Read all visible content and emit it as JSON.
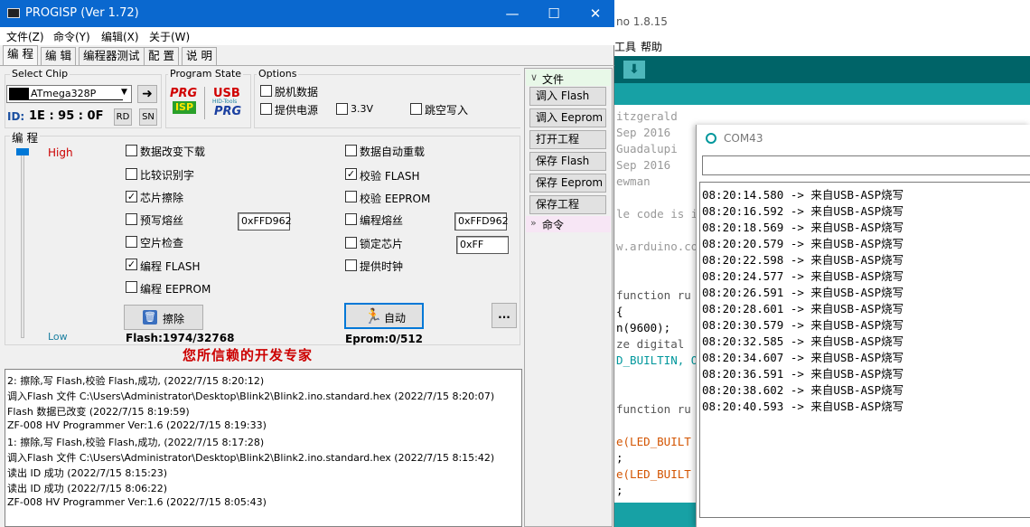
{
  "arduino": {
    "title": "no 1.8.15",
    "menu": [
      "工具",
      "帮助"
    ],
    "code_lines": [
      {
        "t": "itzgerald",
        "c": "#999"
      },
      {
        "t": "Sep 2016",
        "c": "#999"
      },
      {
        "t": "Guadalupi",
        "c": "#999"
      },
      {
        "t": "Sep 2016",
        "c": "#999"
      },
      {
        "t": "ewman",
        "c": "#999"
      },
      {
        "t": "",
        "c": "#999"
      },
      {
        "t": "le code is i",
        "c": "#999"
      },
      {
        "t": "",
        "c": "#999"
      },
      {
        "t": "w.arduino.co",
        "c": "#999"
      },
      {
        "t": "",
        "c": "#000"
      },
      {
        "t": "",
        "c": "#000"
      },
      {
        "t": "function ru",
        "c": "#555"
      },
      {
        "t": "{",
        "c": "#000"
      },
      {
        "t": "n(9600);",
        "c": "#000"
      },
      {
        "t": "ze digital",
        "c": "#555"
      },
      {
        "t": "D_BUILTIN, O",
        "c": "#00979c"
      },
      {
        "t": "",
        "c": "#000"
      },
      {
        "t": "",
        "c": "#000"
      },
      {
        "t": "function ru",
        "c": "#555"
      },
      {
        "t": "",
        "c": "#000"
      },
      {
        "t": "e(LED_BUILT",
        "c": "#d35400"
      },
      {
        "t": ";",
        "c": "#000"
      },
      {
        "t": "e(LED_BUILT",
        "c": "#d35400"
      },
      {
        "t": ";",
        "c": "#000"
      }
    ],
    "serial": {
      "title": "COM43",
      "lines": [
        "08:20:14.580 -> 来自USB-ASP烧写",
        "08:20:16.592 -> 来自USB-ASP烧写",
        "08:20:18.569 -> 来自USB-ASP烧写",
        "08:20:20.579 -> 来自USB-ASP烧写",
        "08:20:22.598 -> 来自USB-ASP烧写",
        "08:20:24.577 -> 来自USB-ASP烧写",
        "08:20:26.591 -> 来自USB-ASP烧写",
        "08:20:28.601 -> 来自USB-ASP烧写",
        "08:20:30.579 -> 来自USB-ASP烧写",
        "08:20:32.585 -> 来自USB-ASP烧写",
        "08:20:34.607 -> 来自USB-ASP烧写",
        "08:20:36.591 -> 来自USB-ASP烧写",
        "08:20:38.602 -> 来自USB-ASP烧写",
        "08:20:40.593 -> 来自USB-ASP烧写"
      ]
    }
  },
  "progisp": {
    "title": "PROGISP (Ver 1.72)",
    "menu": {
      "file": "文件(Z)",
      "command": "命令(Y)",
      "edit": "编辑(X)",
      "about": "关于(W)"
    },
    "tabs": [
      "编 程",
      "编 辑",
      "编程器测试",
      "配 置",
      "说 明"
    ],
    "select_chip": {
      "legend": "Select Chip",
      "value": "ATmega328P"
    },
    "chip_id": {
      "label": "ID:",
      "value": "1E : 95 : 0F",
      "rd": "RD",
      "sn": "SN"
    },
    "program_state": {
      "legend": "Program State",
      "prg": "PRG",
      "isp": "ISP",
      "usb": "USB",
      "usb_sub": "PRG",
      "usb_tag": "HID-Tools"
    },
    "options": {
      "legend": "Options",
      "offline": "脱机数据",
      "power": "提供电源",
      "v33": "3.3V",
      "jump": "跳空写入"
    },
    "program_group": {
      "legend": "编 程",
      "high": "High",
      "low": "Low"
    },
    "left_checks": [
      {
        "label": "数据改变下载",
        "checked": false
      },
      {
        "label": "比较识别字",
        "checked": false
      },
      {
        "label": "芯片擦除",
        "checked": true
      },
      {
        "label": "预写熔丝",
        "checked": false
      },
      {
        "label": "空片检查",
        "checked": false
      },
      {
        "label": "编程 FLASH",
        "checked": true
      },
      {
        "label": "编程 EEPROM",
        "checked": false
      }
    ],
    "right_checks": [
      {
        "label": "数据自动重载",
        "checked": false
      },
      {
        "label": "校验 FLASH",
        "checked": true
      },
      {
        "label": "校验 EEPROM",
        "checked": false
      },
      {
        "label": "编程熔丝",
        "checked": false
      },
      {
        "label": "锁定芯片",
        "checked": false
      },
      {
        "label": "提供时钟",
        "checked": false
      }
    ],
    "hex": {
      "prewrite": "0xFFD962",
      "fuse": "0xFFD962",
      "lock": "0xFF"
    },
    "buttons": {
      "erase": "擦除",
      "auto": "自动",
      "more": "..."
    },
    "flash_info": "Flash:1974/32768",
    "eprom_info": "Eprom:0/512",
    "slogan": "您所信赖的开发专家",
    "side": {
      "file_header": "文件",
      "load_flash": "调入 Flash",
      "load_eeprom": "调入 Eeprom",
      "open_project": "打开工程",
      "save_flash": "保存 Flash",
      "save_eeprom": "保存 Eeprom",
      "save_project": "保存工程",
      "command_header": "命令"
    },
    "log": [
      "2: 擦除,写 Flash,校验 Flash,成功, (2022/7/15 8:20:12)",
      "调入Flash 文件 C:\\Users\\Administrator\\Desktop\\Blink2\\Blink2.ino.standard.hex (2022/7/15 8:20:07)",
      "Flash 数据已改变 (2022/7/15 8:19:59)",
      "ZF-008 HV Programmer Ver:1.6 (2022/7/15 8:19:33)",
      "1: 擦除,写 Flash,校验 Flash,成功, (2022/7/15 8:17:28)",
      "调入Flash 文件 C:\\Users\\Administrator\\Desktop\\Blink2\\Blink2.ino.standard.hex (2022/7/15 8:15:42)",
      "读出 ID 成功 (2022/7/15 8:15:23)",
      "读出 ID 成功 (2022/7/15 8:06:22)",
      "ZF-008 HV Programmer Ver:1.6 (2022/7/15 8:05:43)"
    ],
    "colors": {
      "title_bar": "#0a68cf",
      "high_text": "#cc0000",
      "low_text": "#1a7fa0",
      "slogan": "#cc0000",
      "arduino_teal": "#006468"
    }
  }
}
